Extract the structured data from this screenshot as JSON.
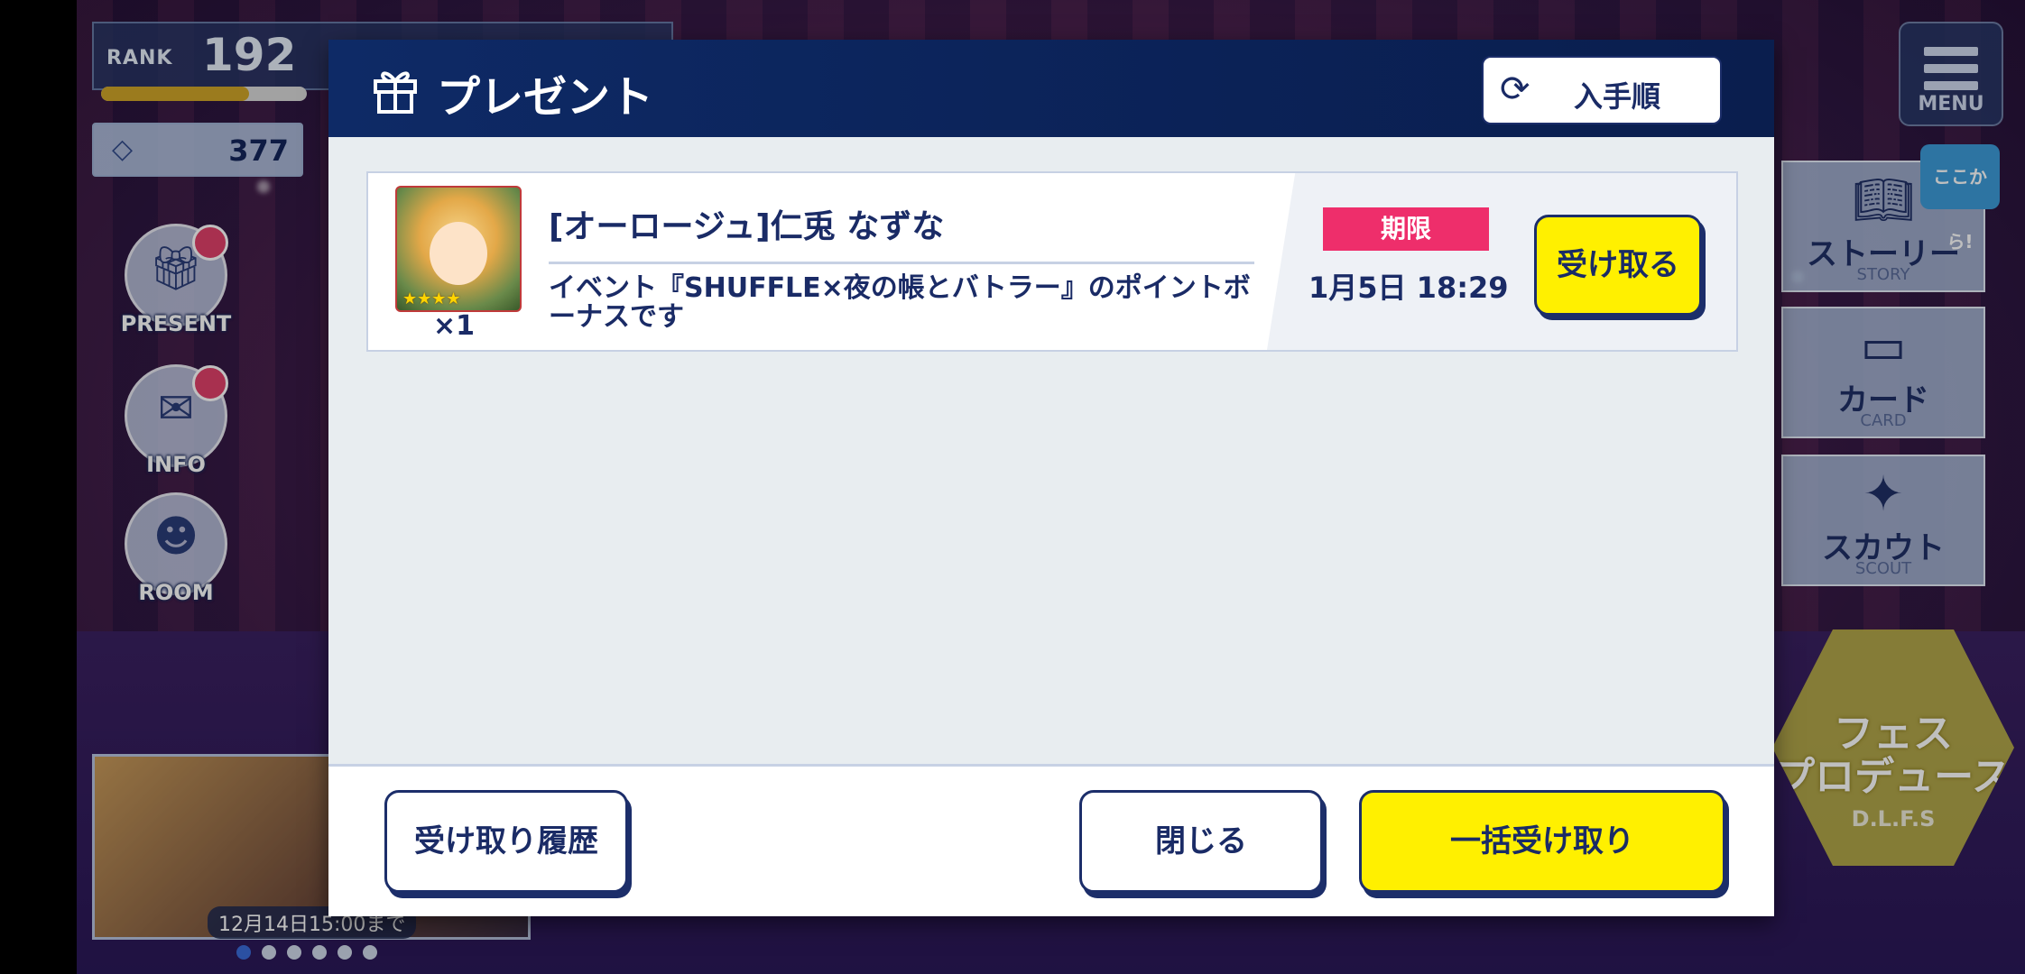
{
  "hud": {
    "rank_label": "RANK",
    "rank_value": "192",
    "rank_progress": 0.72,
    "gem_count": "377",
    "left_buttons": [
      {
        "label": "PRESENT",
        "icon": "gift-icon",
        "has_badge": true
      },
      {
        "label": "INFO",
        "icon": "mail-icon",
        "has_badge": true
      },
      {
        "label": "ROOM",
        "icon": "character-icon",
        "has_badge": false
      }
    ],
    "banner_date": "12月14日15:00まで",
    "carousel_pages": 6,
    "carousel_active": 0,
    "menu_label": "MENU",
    "koko_badge": "ここから!",
    "right_buttons": [
      {
        "title": "ストーリー",
        "sub": "STORY",
        "icon": "book-icon"
      },
      {
        "title": "カード",
        "sub": "CARD",
        "icon": "card-icon"
      },
      {
        "title": "スカウト",
        "sub": "SCOUT",
        "icon": "star-icon"
      }
    ],
    "fes": {
      "title_line1": "フェス",
      "title_line2": "プロデュース",
      "sub": "D.L.F.S"
    }
  },
  "modal": {
    "title": "プレゼント",
    "sort_label": "入手順",
    "items": [
      {
        "name": "[オーロージュ]仁兎 なずな",
        "quantity": "×1",
        "stars": "★★★★",
        "description": "イベント『SHUFFLE×夜の帳とバトラー』のポイントボーナスです",
        "deadline_label": "期限",
        "deadline_time": "1月5日 18:29",
        "receive_label": "受け取る"
      }
    ],
    "footer": {
      "history_label": "受け取り履歴",
      "close_label": "閉じる",
      "bulk_label": "一括受け取り"
    }
  },
  "colors": {
    "header_bg": "#0e2a66",
    "accent_yellow": "#fff000",
    "deadline_pink": "#ee2e6b",
    "text_navy": "#1a2b66"
  }
}
